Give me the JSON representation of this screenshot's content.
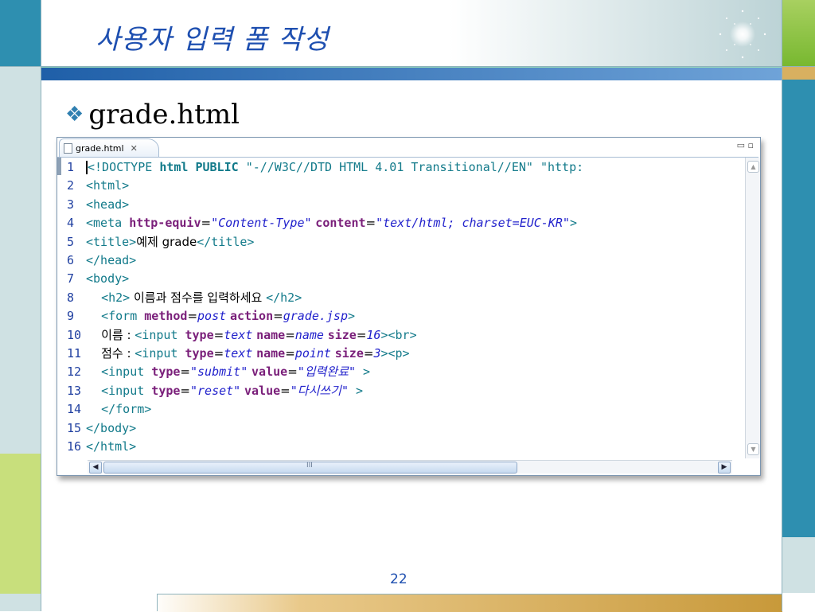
{
  "slide": {
    "title": "사용자 입력 폼 작성",
    "bullet": "grade.html",
    "bullet_icon": "diamond-bullet-icon",
    "page_number": "22",
    "colors": {
      "title": "#1e4fb0",
      "accent_blue": "#2e8fb0",
      "accent_green": "#c8df7c"
    }
  },
  "editor": {
    "tab_label": "grade.html",
    "tab_close": "✕",
    "minimize": "▭",
    "maximize": "▫",
    "lines": [
      {
        "n": "1",
        "parts": [
          [
            "tag",
            "<!DOCTYPE "
          ],
          [
            "kw",
            "html PUBLIC "
          ],
          [
            "tag",
            "\"-//W3C//DTD HTML 4.01 Transitional//EN\" \"http:"
          ]
        ]
      },
      {
        "n": "2",
        "parts": [
          [
            "tag",
            "<html>"
          ]
        ]
      },
      {
        "n": "3",
        "parts": [
          [
            "tag",
            "<head>"
          ]
        ]
      },
      {
        "n": "4",
        "parts": [
          [
            "tag",
            "<meta "
          ],
          [
            "attr",
            "http-equiv"
          ],
          [
            "txt",
            "="
          ],
          [
            "val",
            "\"Content-Type\""
          ],
          [
            "txt",
            " "
          ],
          [
            "attr",
            "content"
          ],
          [
            "txt",
            "="
          ],
          [
            "val",
            "\"text/html; charset=EUC-KR\""
          ],
          [
            "tag",
            ">"
          ]
        ]
      },
      {
        "n": "5",
        "parts": [
          [
            "tag",
            "<title>"
          ],
          [
            "txt",
            "예제 grade"
          ],
          [
            "tag",
            "</title>"
          ]
        ]
      },
      {
        "n": "6",
        "parts": [
          [
            "tag",
            "</head>"
          ]
        ]
      },
      {
        "n": "7",
        "parts": [
          [
            "tag",
            "<body>"
          ]
        ]
      },
      {
        "n": "8",
        "parts": [
          [
            "txt",
            "    "
          ],
          [
            "tag",
            "<h2>"
          ],
          [
            "txt",
            " 이름과 점수를 입력하세요 "
          ],
          [
            "tag",
            "</h2>"
          ]
        ]
      },
      {
        "n": "9",
        "parts": [
          [
            "txt",
            "    "
          ],
          [
            "tag",
            "<form "
          ],
          [
            "attr",
            "method"
          ],
          [
            "txt",
            "="
          ],
          [
            "val",
            "post"
          ],
          [
            "txt",
            " "
          ],
          [
            "attr",
            "action"
          ],
          [
            "txt",
            "="
          ],
          [
            "val",
            "grade.jsp"
          ],
          [
            "tag",
            ">"
          ]
        ]
      },
      {
        "n": "10",
        "parts": [
          [
            "txt",
            "    이름 : "
          ],
          [
            "tag",
            "<input "
          ],
          [
            "attr",
            "type"
          ],
          [
            "txt",
            "="
          ],
          [
            "val",
            "text"
          ],
          [
            "txt",
            " "
          ],
          [
            "attr",
            "name"
          ],
          [
            "txt",
            "="
          ],
          [
            "val",
            "name"
          ],
          [
            "txt",
            " "
          ],
          [
            "attr",
            "size"
          ],
          [
            "txt",
            "="
          ],
          [
            "val",
            "16"
          ],
          [
            "tag",
            "><br>"
          ]
        ]
      },
      {
        "n": "11",
        "parts": [
          [
            "txt",
            "    점수 : "
          ],
          [
            "tag",
            "<input "
          ],
          [
            "attr",
            "type"
          ],
          [
            "txt",
            "="
          ],
          [
            "val",
            "text"
          ],
          [
            "txt",
            " "
          ],
          [
            "attr",
            "name"
          ],
          [
            "txt",
            "="
          ],
          [
            "val",
            "point"
          ],
          [
            "txt",
            " "
          ],
          [
            "attr",
            "size"
          ],
          [
            "txt",
            "="
          ],
          [
            "val",
            "3"
          ],
          [
            "tag",
            "><p>"
          ]
        ]
      },
      {
        "n": "12",
        "parts": [
          [
            "txt",
            "    "
          ],
          [
            "tag",
            "<input "
          ],
          [
            "attr",
            "type"
          ],
          [
            "txt",
            "="
          ],
          [
            "val",
            "\"submit\""
          ],
          [
            "txt",
            " "
          ],
          [
            "attr",
            "value"
          ],
          [
            "txt",
            "="
          ],
          [
            "val",
            "\"입력완료\""
          ],
          [
            "tag",
            " >"
          ]
        ]
      },
      {
        "n": "13",
        "parts": [
          [
            "txt",
            "    "
          ],
          [
            "tag",
            "<input "
          ],
          [
            "attr",
            "type"
          ],
          [
            "txt",
            "="
          ],
          [
            "val",
            "\"reset\""
          ],
          [
            "txt",
            " "
          ],
          [
            "attr",
            "value"
          ],
          [
            "txt",
            "="
          ],
          [
            "val",
            "\"다시쓰기\""
          ],
          [
            "tag",
            " >"
          ]
        ]
      },
      {
        "n": "14",
        "parts": [
          [
            "txt",
            "    "
          ],
          [
            "tag",
            "</form>"
          ]
        ]
      },
      {
        "n": "15",
        "parts": [
          [
            "tag",
            "</body>"
          ]
        ]
      },
      {
        "n": "16",
        "parts": [
          [
            "tag",
            "</html>"
          ]
        ]
      }
    ],
    "scroll": {
      "up": "▲",
      "down": "▼",
      "left": "◀",
      "right": "▶",
      "thumb_grip": "III"
    }
  }
}
